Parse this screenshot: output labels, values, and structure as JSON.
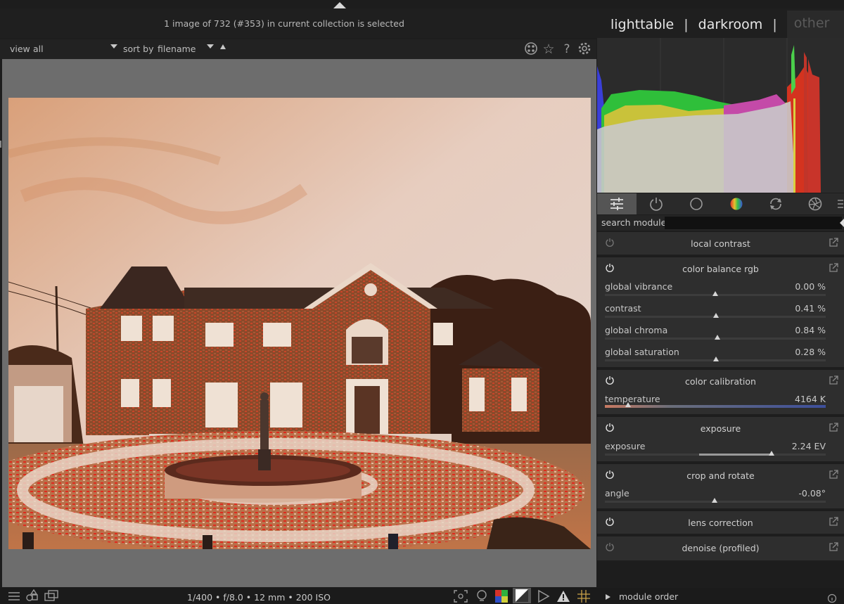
{
  "header": {
    "collection_info": "1 image of 732 (#353) in current collection is selected",
    "views": [
      "lighttable",
      "darkroom",
      "other"
    ],
    "separator": "|"
  },
  "filterbar": {
    "view_label": "view",
    "view_value": "all",
    "sort_label": "sort by",
    "sort_value": "filename"
  },
  "search": {
    "label": "search module",
    "value": ""
  },
  "modules": [
    {
      "title": "local contrast",
      "enabled": false
    },
    {
      "title": "color balance rgb",
      "enabled": true,
      "sliders": [
        {
          "label": "global vibrance",
          "value": "0.00 %"
        },
        {
          "label": "contrast",
          "value": "0.41 %"
        },
        {
          "label": "global chroma",
          "value": "0.84 %"
        },
        {
          "label": "global saturation",
          "value": "0.28 %"
        }
      ]
    },
    {
      "title": "color calibration",
      "enabled": true,
      "sliders": [
        {
          "label": "temperature",
          "value": "4164 K"
        }
      ]
    },
    {
      "title": "exposure",
      "enabled": true,
      "sliders": [
        {
          "label": "exposure",
          "value": "2.24 EV"
        }
      ]
    },
    {
      "title": "crop and rotate",
      "enabled": true,
      "sliders": [
        {
          "label": "angle",
          "value": "-0.08°"
        }
      ]
    },
    {
      "title": "lens correction",
      "enabled": true
    },
    {
      "title": "denoise (profiled)",
      "enabled": false
    }
  ],
  "bottombar": {
    "exif": "1/400 • f/8.0 • 12 mm • 200 ISO",
    "module_order_label": "module order"
  },
  "icons": {
    "top_right": [
      "focus-peaking-icon",
      "star-icon",
      "help-icon",
      "gear-icon"
    ],
    "group_tabs": [
      "sliders-icon",
      "power-icon",
      "circle-icon",
      "color-wheel-icon",
      "rotate-icon",
      "aperture-icon"
    ],
    "bottom_left": [
      "filmstrip-icon",
      "shapes-icon",
      "window-icon"
    ],
    "bottom_center": [
      "focus-icon",
      "bulb-icon",
      "rgb-squares-icon",
      "gamut-icon",
      "softproof-icon",
      "warning-icon",
      "grid-icon"
    ]
  },
  "colors": {
    "accent_bg": "#1d1d1d",
    "panel": "#2e2e2e",
    "image_border": "#6d6d6d",
    "temperature_gradient": [
      "#d77a5a",
      "#6b6e7a",
      "#3b4ea8"
    ]
  }
}
